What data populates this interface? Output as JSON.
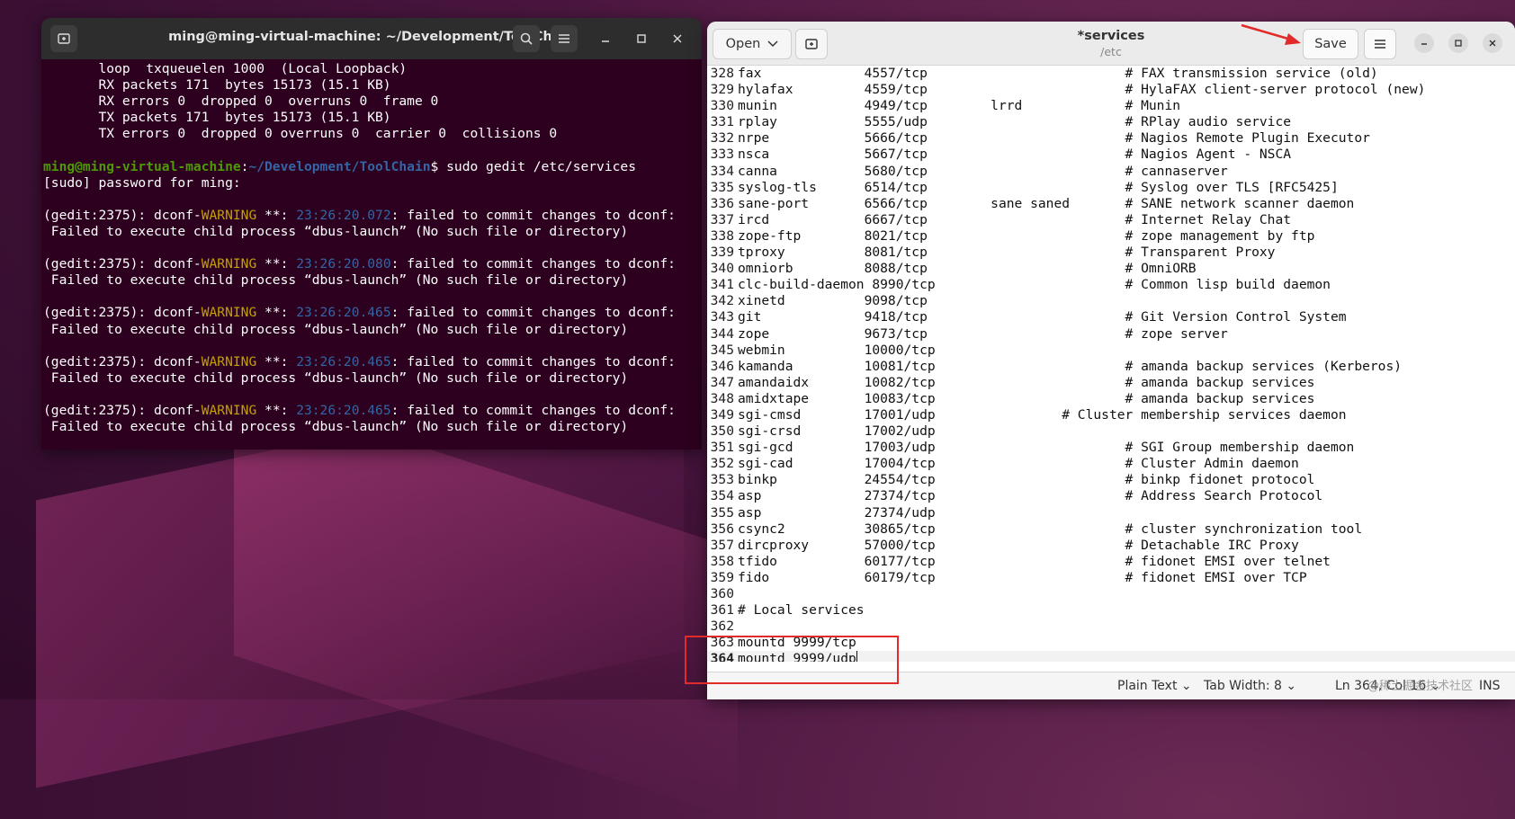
{
  "terminal": {
    "title": "ming@ming-virtual-machine: ~/Development/ToolChain",
    "lines": [
      {
        "text": "       loop  txqueuelen 1000  (Local Loopback)"
      },
      {
        "text": "       RX packets 171  bytes 15173 (15.1 KB)"
      },
      {
        "text": "       RX errors 0  dropped 0  overruns 0  frame 0"
      },
      {
        "text": "       TX packets 171  bytes 15173 (15.1 KB)"
      },
      {
        "text": "       TX errors 0  dropped 0 overruns 0  carrier 0  collisions 0"
      },
      {
        "text": ""
      },
      {
        "prompt_user": "ming@ming-virtual-machine",
        "prompt_sep": ":",
        "prompt_path": "~/Development/ToolChain",
        "prompt_cmd": "$ sudo gedit /etc/services"
      },
      {
        "text": "[sudo] password for ming:"
      },
      {
        "text": ""
      },
      {
        "w_pre": "(gedit:2375): dconf-",
        "w_warn": "WARNING",
        "w_mid": " **: ",
        "w_time": "23:26:20.072",
        "w_post": ": failed to commit changes to dconf:"
      },
      {
        "text": " Failed to execute child process “dbus-launch” (No such file or directory)"
      },
      {
        "text": ""
      },
      {
        "w_pre": "(gedit:2375): dconf-",
        "w_warn": "WARNING",
        "w_mid": " **: ",
        "w_time": "23:26:20.080",
        "w_post": ": failed to commit changes to dconf:"
      },
      {
        "text": " Failed to execute child process “dbus-launch” (No such file or directory)"
      },
      {
        "text": ""
      },
      {
        "w_pre": "(gedit:2375): dconf-",
        "w_warn": "WARNING",
        "w_mid": " **: ",
        "w_time": "23:26:20.465",
        "w_post": ": failed to commit changes to dconf:"
      },
      {
        "text": " Failed to execute child process “dbus-launch” (No such file or directory)"
      },
      {
        "text": ""
      },
      {
        "w_pre": "(gedit:2375): dconf-",
        "w_warn": "WARNING",
        "w_mid": " **: ",
        "w_time": "23:26:20.465",
        "w_post": ": failed to commit changes to dconf:"
      },
      {
        "text": " Failed to execute child process “dbus-launch” (No such file or directory)"
      },
      {
        "text": ""
      },
      {
        "w_pre": "(gedit:2375): dconf-",
        "w_warn": "WARNING",
        "w_mid": " **: ",
        "w_time": "23:26:20.465",
        "w_post": ": failed to commit changes to dconf:"
      },
      {
        "text": " Failed to execute child process “dbus-launch” (No such file or directory)"
      },
      {
        "text": ""
      }
    ]
  },
  "gedit": {
    "open_label": "Open",
    "title": "*services",
    "subtitle": "/etc",
    "save_label": "Save",
    "lines": [
      {
        "n": "328",
        "t": "fax             4557/tcp                         # FAX transmission service (old)"
      },
      {
        "n": "329",
        "t": "hylafax         4559/tcp                         # HylaFAX client-server protocol (new)"
      },
      {
        "n": "330",
        "t": "munin           4949/tcp        lrrd             # Munin"
      },
      {
        "n": "331",
        "t": "rplay           5555/udp                         # RPlay audio service"
      },
      {
        "n": "332",
        "t": "nrpe            5666/tcp                         # Nagios Remote Plugin Executor"
      },
      {
        "n": "333",
        "t": "nsca            5667/tcp                         # Nagios Agent - NSCA"
      },
      {
        "n": "334",
        "t": "canna           5680/tcp                         # cannaserver"
      },
      {
        "n": "335",
        "t": "syslog-tls      6514/tcp                         # Syslog over TLS [RFC5425]"
      },
      {
        "n": "336",
        "t": "sane-port       6566/tcp        sane saned       # SANE network scanner daemon"
      },
      {
        "n": "337",
        "t": "ircd            6667/tcp                         # Internet Relay Chat"
      },
      {
        "n": "338",
        "t": "zope-ftp        8021/tcp                         # zope management by ftp"
      },
      {
        "n": "339",
        "t": "tproxy          8081/tcp                         # Transparent Proxy"
      },
      {
        "n": "340",
        "t": "omniorb         8088/tcp                         # OmniORB"
      },
      {
        "n": "341",
        "t": "clc-build-daemon 8990/tcp                        # Common lisp build daemon"
      },
      {
        "n": "342",
        "t": "xinetd          9098/tcp"
      },
      {
        "n": "343",
        "t": "git             9418/tcp                         # Git Version Control System"
      },
      {
        "n": "344",
        "t": "zope            9673/tcp                         # zope server"
      },
      {
        "n": "345",
        "t": "webmin          10000/tcp"
      },
      {
        "n": "346",
        "t": "kamanda         10081/tcp                        # amanda backup services (Kerberos)"
      },
      {
        "n": "347",
        "t": "amandaidx       10082/tcp                        # amanda backup services"
      },
      {
        "n": "348",
        "t": "amidxtape       10083/tcp                        # amanda backup services"
      },
      {
        "n": "349",
        "t": "sgi-cmsd        17001/udp                # Cluster membership services daemon"
      },
      {
        "n": "350",
        "t": "sgi-crsd        17002/udp"
      },
      {
        "n": "351",
        "t": "sgi-gcd         17003/udp                        # SGI Group membership daemon"
      },
      {
        "n": "352",
        "t": "sgi-cad         17004/tcp                        # Cluster Admin daemon"
      },
      {
        "n": "353",
        "t": "binkp           24554/tcp                        # binkp fidonet protocol"
      },
      {
        "n": "354",
        "t": "asp             27374/tcp                        # Address Search Protocol"
      },
      {
        "n": "355",
        "t": "asp             27374/udp"
      },
      {
        "n": "356",
        "t": "csync2          30865/tcp                        # cluster synchronization tool"
      },
      {
        "n": "357",
        "t": "dircproxy       57000/tcp                        # Detachable IRC Proxy"
      },
      {
        "n": "358",
        "t": "tfido           60177/tcp                        # fidonet EMSI over telnet"
      },
      {
        "n": "359",
        "t": "fido            60179/tcp                        # fidonet EMSI over TCP"
      },
      {
        "n": "360",
        "t": ""
      },
      {
        "n": "361",
        "t": "# Local services"
      },
      {
        "n": "362",
        "t": ""
      },
      {
        "n": "363",
        "t": "mountd 9999/tcp"
      },
      {
        "n": "364",
        "t": "mountd 9999/udp",
        "current": true
      }
    ],
    "status": {
      "language": "Plain Text",
      "tab_width": "Tab Width: 8",
      "position": "Ln 364, Col 16",
      "mode": "INS"
    }
  },
  "watermark": "@稀土掘金技术社区",
  "colors": {
    "annotation": "#e12b2b",
    "terminal_bg": "#2c001e",
    "prompt_user": "#4e9a06",
    "prompt_path": "#3465a4",
    "warning": "#c4a000"
  }
}
